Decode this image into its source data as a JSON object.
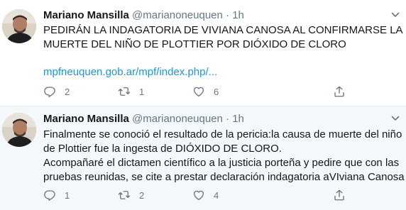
{
  "tweets": [
    {
      "author_name": "Mariano Mansilla",
      "handle": "@marianoneuquen",
      "separator": "·",
      "time": "1h",
      "text_lines": [
        "PEDIRÁN LA INDAGATORIA DE VIVIANA CANOSA AL CONFIRMARSE LA",
        "MUERTE DEL NIÑO DE PLOTTIER  POR  DIÓXIDO DE CLORO"
      ],
      "link": "mpfneuquen.gob.ar/mpf/index.php/...",
      "reply_count": "2",
      "retweet_count": "1",
      "like_count": "6"
    },
    {
      "author_name": "Mariano Mansilla",
      "handle": "@marianoneuquen",
      "separator": "·",
      "time": "1h",
      "text_lines": [
        "Finalmente se conoció el resultado de la pericia:la causa de muerte del niño",
        "de Plottier fue la ingesta de DIÓXIDO DE CLORO.",
        "Acompañaré el dictamen científico a la justicia porteña y pedire que con las",
        "pruebas reunidas, se cite a prestar declaración indagatoria aVIviana Canosa"
      ],
      "reply_count": "1",
      "retweet_count": "2",
      "like_count": "4"
    }
  ],
  "icons": {
    "reply": "reply-icon",
    "retweet": "retweet-icon",
    "like": "like-icon",
    "share": "share-icon",
    "more": "chevron-down-icon"
  },
  "colors": {
    "text": "#14171a",
    "secondary": "#657786",
    "link": "#1b95e0",
    "highlight_bg": "#f5f8fa",
    "divider": "#e6ecf0"
  }
}
